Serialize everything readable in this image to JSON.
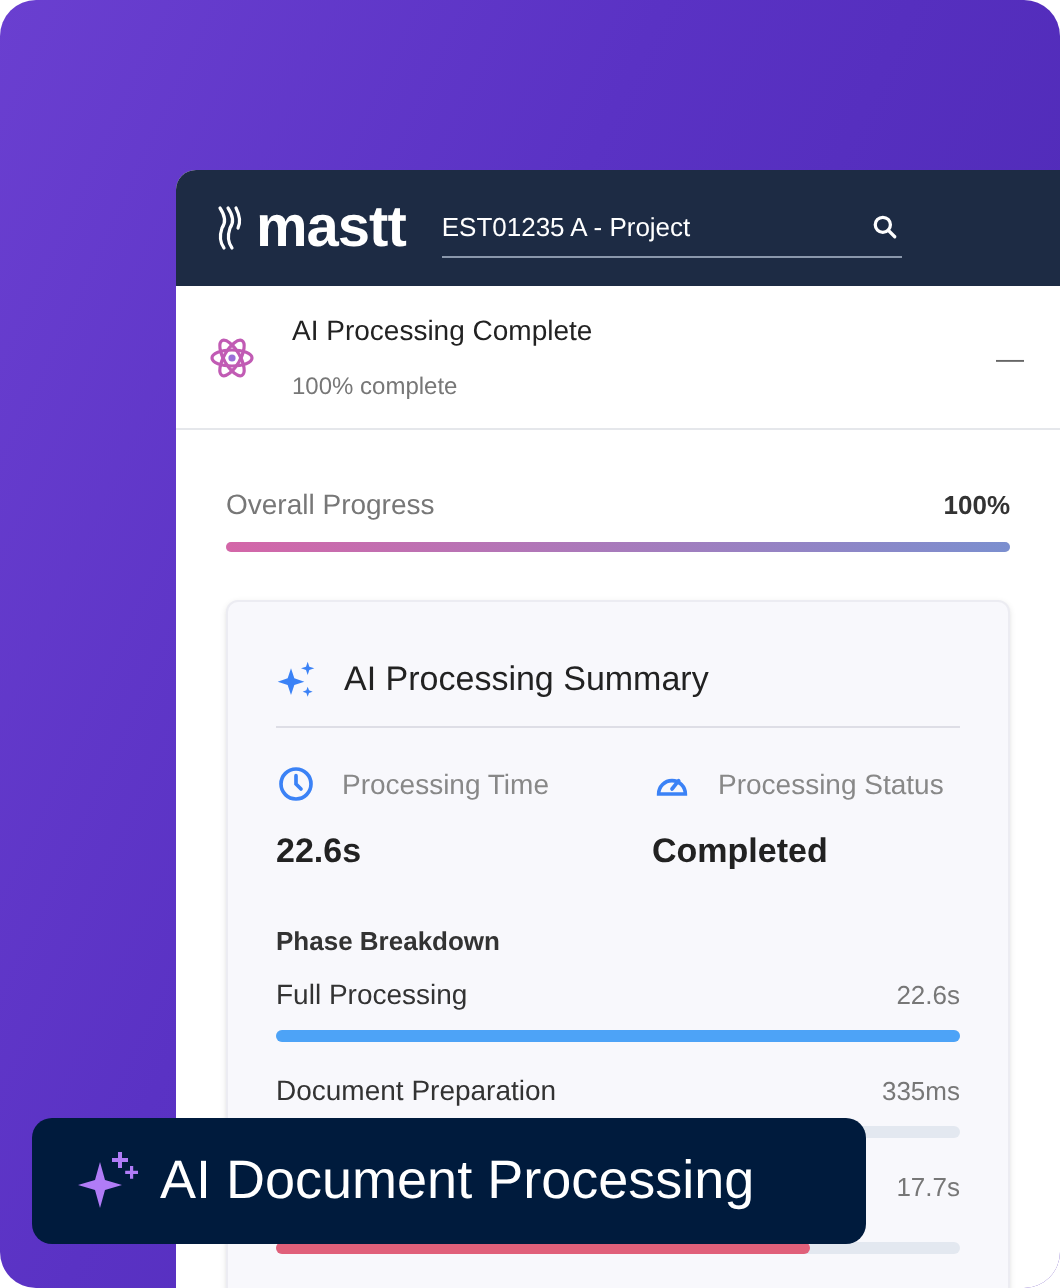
{
  "header": {
    "logo": "mastt",
    "search": {
      "value": "EST01235 A - Project"
    }
  },
  "status": {
    "title": "AI Processing Complete",
    "subtitle": "100% complete",
    "collapse": "—"
  },
  "overall": {
    "label": "Overall Progress",
    "reading": "100%",
    "level": 1
  },
  "summary": {
    "title": "AI Processing Summary",
    "stats": [
      {
        "kind": "time",
        "label": "Processing Time",
        "value": "22.6s"
      },
      {
        "kind": "status",
        "label": "Processing Status",
        "value": "Completed"
      }
    ],
    "phase_title": "Phase Breakdown",
    "phases": [
      {
        "name": "Full Processing",
        "reading": "22.6s",
        "level": 1,
        "color": "#4da3f7"
      },
      {
        "name": "Document Preparation",
        "reading": "335ms"
      },
      {
        "reading": "17.7s",
        "level": 0.78,
        "color": "#e0607a"
      }
    ]
  },
  "badge": {
    "label": "AI Document Processing"
  }
}
